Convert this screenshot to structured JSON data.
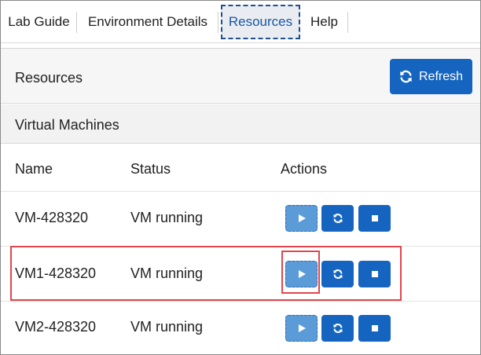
{
  "tabs": [
    {
      "label": "Lab Guide",
      "active": false
    },
    {
      "label": "Environment Details",
      "active": false
    },
    {
      "label": "Resources",
      "active": true
    },
    {
      "label": "Help",
      "active": false
    }
  ],
  "resources": {
    "title": "Resources",
    "refresh_label": "Refresh"
  },
  "vm_section": {
    "title": "Virtual Machines",
    "columns": {
      "name": "Name",
      "status": "Status",
      "actions": "Actions"
    },
    "rows": [
      {
        "name": "VM-428320",
        "status": "VM running"
      },
      {
        "name": "VM1-428320",
        "status": "VM running"
      },
      {
        "name": "VM2-428320",
        "status": "VM running"
      }
    ]
  },
  "colors": {
    "primary": "#1565c0",
    "play_button": "#5b9bd8",
    "highlight": "#e0474c"
  }
}
